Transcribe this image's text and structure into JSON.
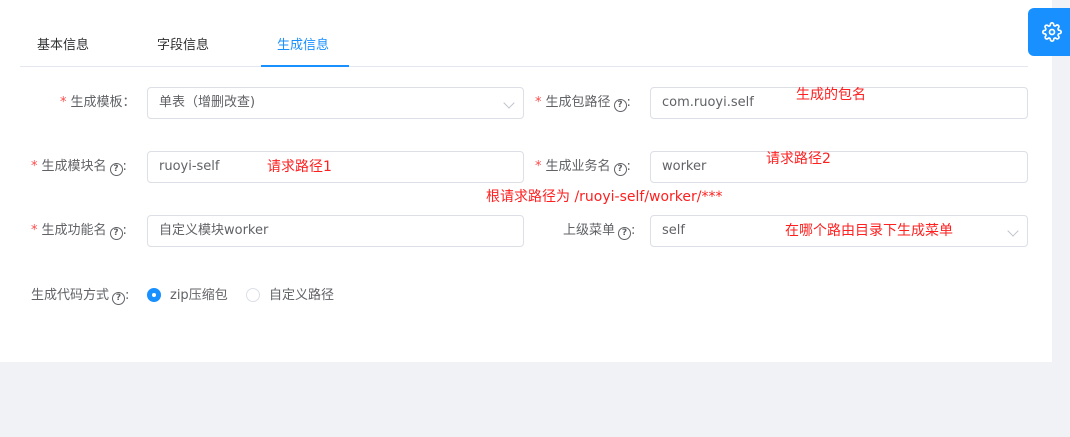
{
  "tabs": [
    {
      "label": "基本信息"
    },
    {
      "label": "字段信息"
    },
    {
      "label": "生成信息"
    }
  ],
  "form": {
    "template": {
      "label": "生成模板：",
      "value": "单表（增删改查)"
    },
    "package_path": {
      "label": "生成包路径",
      "value": "com.ruoyi.self"
    },
    "module_name": {
      "label": "生成模块名",
      "value": "ruoyi-self"
    },
    "business_name": {
      "label": "生成业务名",
      "value": "worker"
    },
    "function_name": {
      "label": "生成功能名",
      "value": "自定义模块worker"
    },
    "parent_menu": {
      "label": "上级菜单",
      "value": "self"
    },
    "gen_type": {
      "label": "生成代码方式",
      "options": [
        {
          "label": "zip压缩包",
          "checked": true
        },
        {
          "label": "自定义路径",
          "checked": false
        }
      ]
    }
  },
  "annotations": {
    "package_name": "生成的包名",
    "path1": "请求路径1",
    "path2": "请求路径2",
    "full_path": "根请求路径为  /ruoyi-self/worker/***",
    "menu_dir": "在哪个路由目录下生成菜单"
  },
  "colors": {
    "accent": "#1890ff",
    "required": "#ff4949",
    "annotation": "#ff1f1f"
  },
  "icons": {
    "settings": "gear-icon"
  }
}
